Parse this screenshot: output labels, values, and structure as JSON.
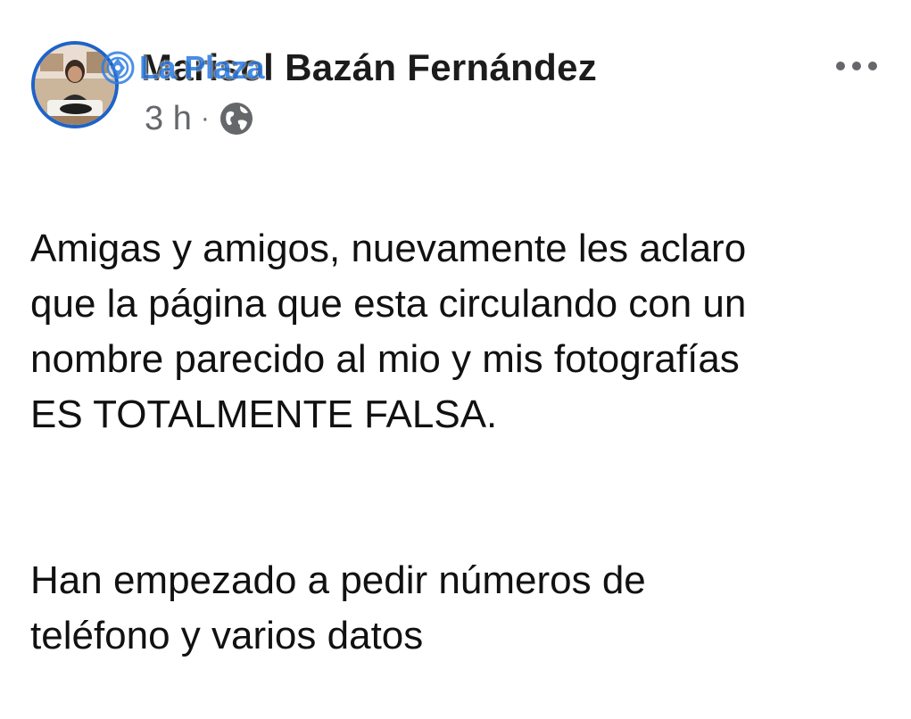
{
  "post": {
    "author": {
      "name": "Marisol Bazán Fernández",
      "avatar_icon": "profile-photo"
    },
    "meta": {
      "time": "3 h",
      "separator": "·",
      "audience_icon": "globe-icon"
    },
    "more_icon": "more-horizontal-icon",
    "text": {
      "paragraph_1": "Amigas y amigos, nuevamente les aclaro\nque la página que esta circulando con un\nnombre parecido al mio y mis fotografías\nES TOTALMENTE FALSA.",
      "paragraph_2": "Han empezado a pedir números de\nteléfono y varios datos"
    }
  },
  "watermark": {
    "text": "La Plaza",
    "color": "#2f7de1"
  },
  "colors": {
    "avatar_ring": "#1d63c9",
    "meta_text": "#65676b"
  }
}
